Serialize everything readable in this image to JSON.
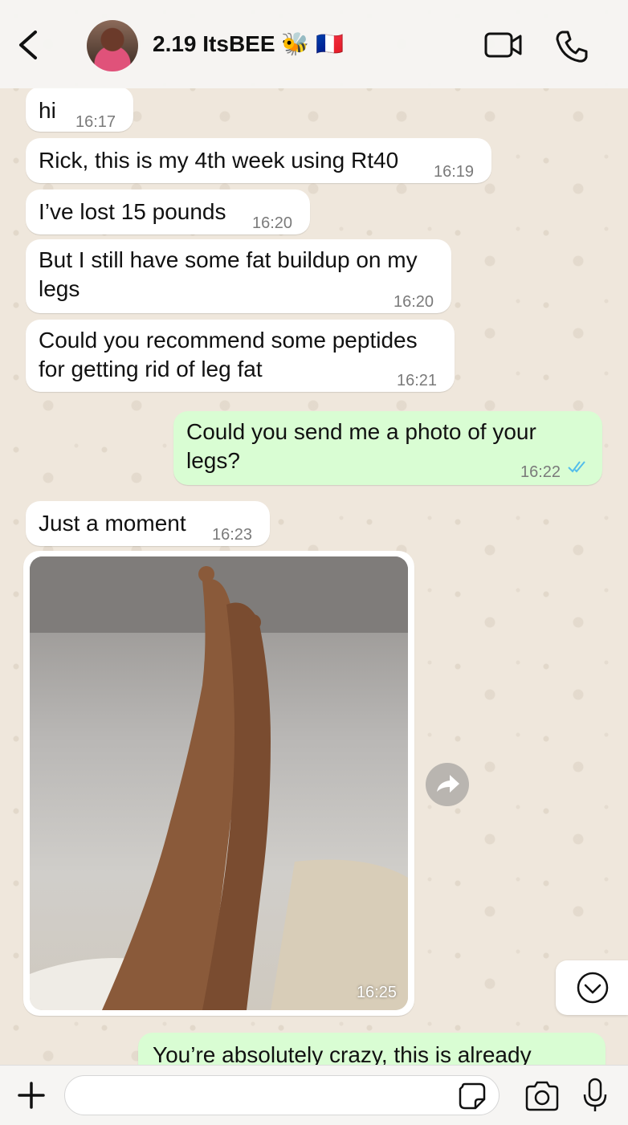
{
  "header": {
    "contact_name": "2.19 ItsBEE 🐝 🇫🇷",
    "icons": [
      "back-arrow-icon",
      "video-call-icon",
      "phone-icon"
    ]
  },
  "messages": [
    {
      "dir": "in",
      "text": "hi",
      "time": "16:17"
    },
    {
      "dir": "in",
      "text": "Rick, this is my 4th week using Rt40",
      "time": "16:19"
    },
    {
      "dir": "in",
      "text": "I’ve lost 15 pounds",
      "time": "16:20"
    },
    {
      "dir": "in",
      "text": "But I still have some fat buildup on my legs",
      "time": "16:20"
    },
    {
      "dir": "in",
      "text": "Could you recommend some peptides for getting rid of leg fat",
      "time": "16:21"
    },
    {
      "dir": "out",
      "text": "Could you send me a photo of your legs?",
      "time": "16:22",
      "status": "read"
    },
    {
      "dir": "in",
      "text": "Just a moment",
      "time": "16:23"
    },
    {
      "dir": "in",
      "type": "image",
      "time": "16:25"
    },
    {
      "dir": "out",
      "text": "You’re absolutely crazy, this is already",
      "time": ""
    }
  ],
  "input": {
    "placeholder": ""
  },
  "colors": {
    "incoming": "#ffffff",
    "outgoing": "#d9fdd3",
    "read_ticks": "#53bdeb"
  }
}
